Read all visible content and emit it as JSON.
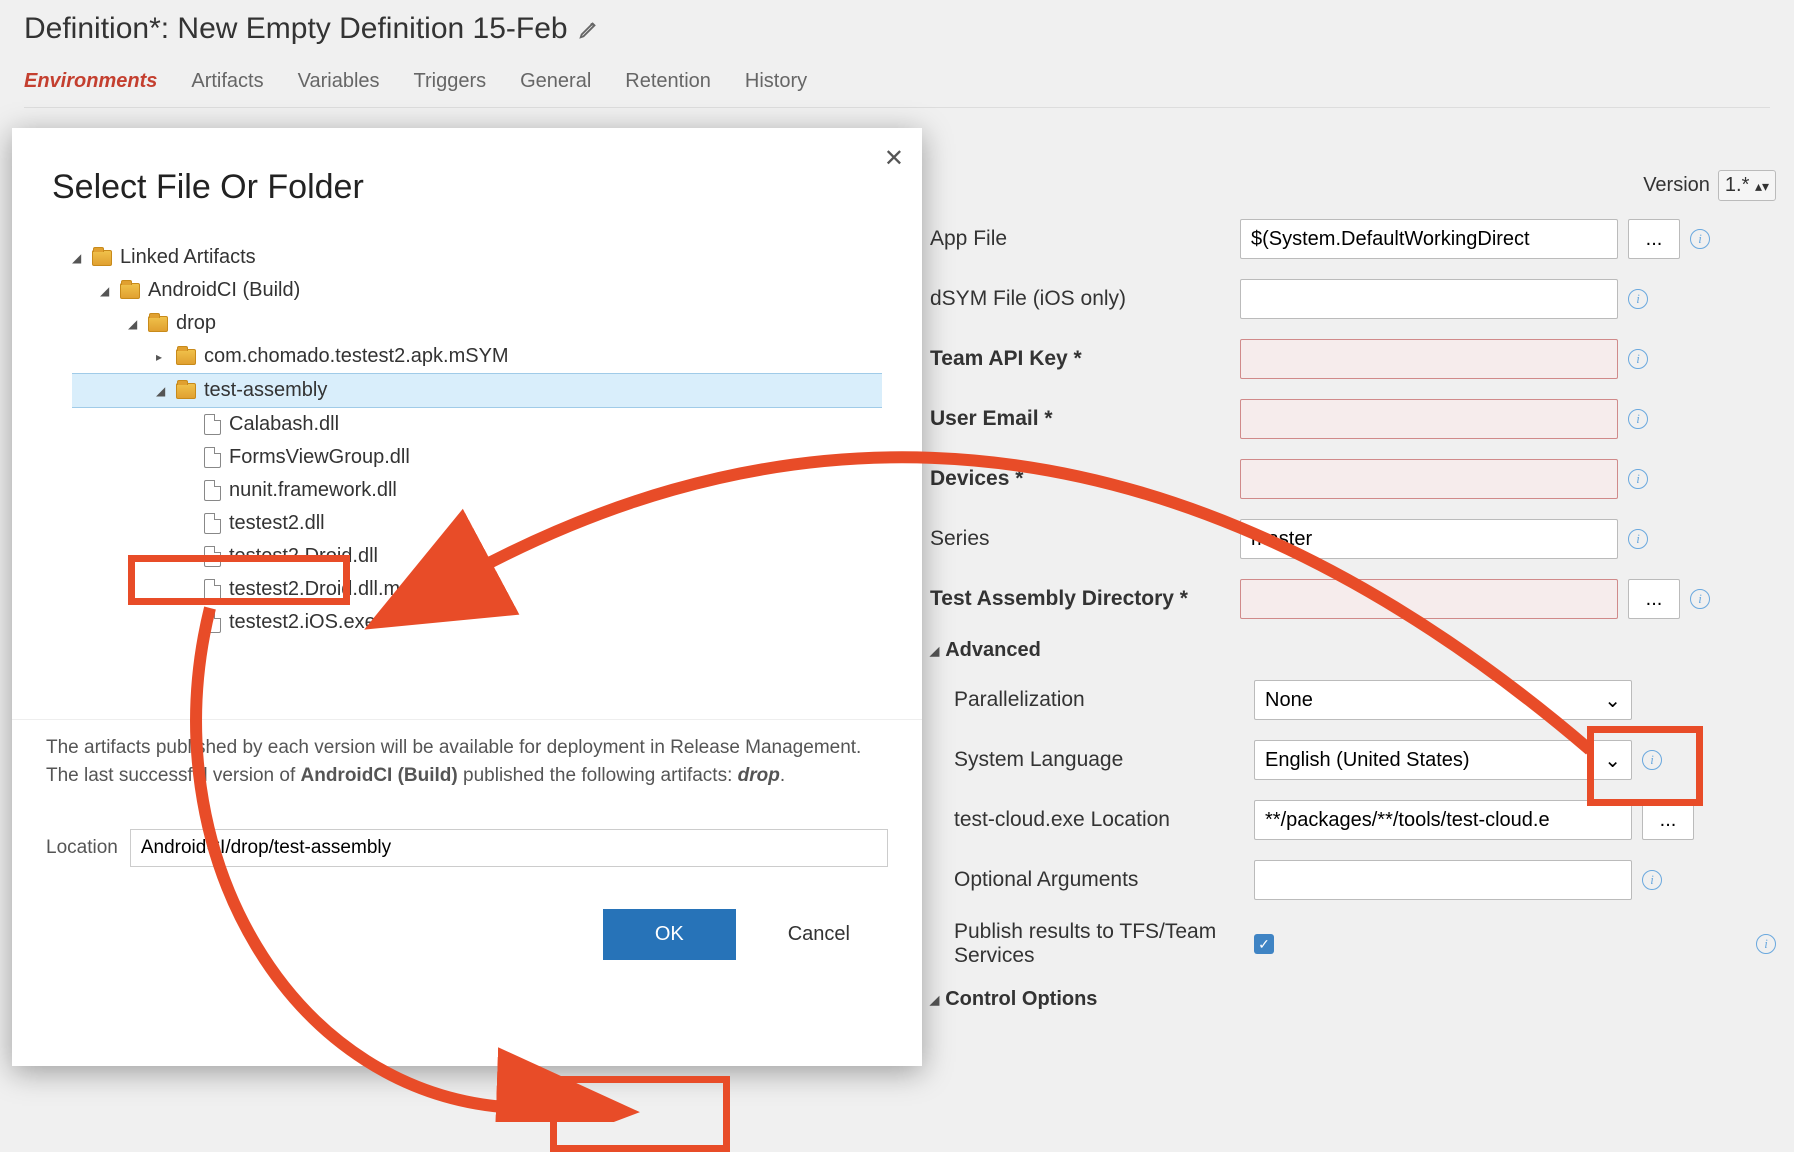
{
  "header": {
    "title": "Definition*: New Empty Definition 15-Feb"
  },
  "tabs": {
    "environments": "Environments",
    "artifacts": "Artifacts",
    "variables": "Variables",
    "triggers": "Triggers",
    "general": "General",
    "retention": "Retention",
    "history": "History"
  },
  "form": {
    "version_label": "Version",
    "version_value": "1.*",
    "app_file_label": "App File",
    "app_file_value": "$(System.DefaultWorkingDirect",
    "dsym_label": "dSYM File (iOS only)",
    "team_api_label": "Team API Key *",
    "user_email_label": "User Email *",
    "devices_label": "Devices *",
    "series_label": "Series",
    "series_value": "master",
    "test_asm_label": "Test Assembly Directory *",
    "advanced_label": "Advanced",
    "parallel_label": "Parallelization",
    "parallel_value": "None",
    "syslang_label": "System Language",
    "syslang_value": "English (United States)",
    "tcloud_label": "test-cloud.exe Location",
    "tcloud_value": "**/packages/**/tools/test-cloud.e",
    "optargs_label": "Optional Arguments",
    "publish_label": "Publish results to TFS/Team Services",
    "control_label": "Control Options",
    "browse": "..."
  },
  "dialog": {
    "title": "Select File Or Folder",
    "tree": {
      "root": "Linked Artifacts",
      "build": "AndroidCI (Build)",
      "drop": "drop",
      "apk": "com.chomado.testest2.apk.mSYM",
      "testasm": "test-assembly",
      "files": {
        "f0": "Calabash.dll",
        "f1": "FormsViewGroup.dll",
        "f2": "nunit.framework.dll",
        "f3": "testest2.dll",
        "f4": "testest2.Droid.dll",
        "f5": "testest2.Droid.dll.mdb",
        "f6": "testest2.iOS.exe"
      }
    },
    "note_part1": "The artifacts published by each version will be available for deployment in Release Management. The last successful version of ",
    "note_build": "AndroidCI (Build)",
    "note_part2": " published the following artifacts: ",
    "note_drop": "drop",
    "note_end": ".",
    "location_label": "Location",
    "location_value": "AndroidCI/drop/test-assembly",
    "ok": "OK",
    "cancel": "Cancel"
  }
}
